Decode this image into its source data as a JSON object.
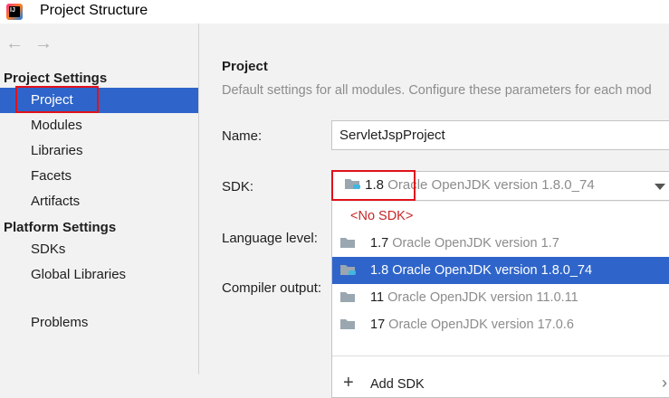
{
  "window": {
    "title": "Project Structure",
    "logo_text": "IJ"
  },
  "nav": {
    "back": "←",
    "forward": "→"
  },
  "sidebar": {
    "project_settings_heading": "Project Settings",
    "project_settings_items": [
      "Project",
      "Modules",
      "Libraries",
      "Facets",
      "Artifacts"
    ],
    "platform_settings_heading": "Platform Settings",
    "platform_settings_items": [
      "SDKs",
      "Global Libraries"
    ],
    "other_items": [
      "Problems"
    ],
    "selected": "Project"
  },
  "main": {
    "title": "Project",
    "description": "Default settings for all modules. Configure these parameters for each mod",
    "name_label": "Name:",
    "name_value": "ServletJspProject",
    "sdk_label": "SDK:",
    "sdk_selected": {
      "version": "1.8",
      "description": "Oracle OpenJDK version 1.8.0_74"
    },
    "language_level_label": "Language level:",
    "compiler_output_label": "Compiler output:"
  },
  "sdk_dropdown": {
    "no_sdk": "<No SDK>",
    "options": [
      {
        "version": "1.7",
        "description": "Oracle OpenJDK version 1.7",
        "selected": false
      },
      {
        "version": "1.8",
        "description": "Oracle OpenJDK version 1.8.0_74",
        "selected": true
      },
      {
        "version": "11",
        "description": "Oracle OpenJDK version 11.0.11",
        "selected": false
      },
      {
        "version": "17",
        "description": "Oracle OpenJDK version 17.0.6",
        "selected": false
      }
    ],
    "add_sdk": "Add SDK",
    "plus_symbol": "+",
    "submenu_arrow": "›"
  },
  "icons": {
    "app_logo": "intellij-logo-icon",
    "back": "arrow-left-icon",
    "forward": "arrow-right-icon",
    "sdk": "jdk-folder-icon",
    "dropdown": "chevron-down-icon",
    "add": "plus-icon",
    "submenu": "chevron-right-icon"
  },
  "colors": {
    "selection": "#2f65ca",
    "highlight_box": "#e0121b",
    "no_sdk_text": "#c62828",
    "muted_text": "#8c8c8c"
  }
}
